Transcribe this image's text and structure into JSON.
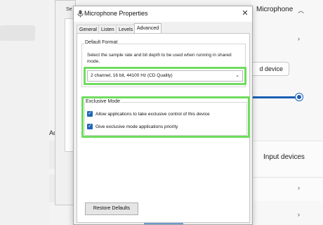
{
  "background": {
    "ad_label": "Ad",
    "microphone_label": "Microphone",
    "add_device_label": "d device",
    "input_devices_label": "Input devices",
    "accent": "#1a5fb4"
  },
  "behind_dialog": {
    "title_fragment": "Se"
  },
  "dialog": {
    "title": "Microphone Properties",
    "close_glyph": "✕",
    "tabs": [
      {
        "label": "General"
      },
      {
        "label": "Listen"
      },
      {
        "label": "Levels"
      },
      {
        "label": "Advanced",
        "active": true
      }
    ],
    "default_format": {
      "group_label": "Default Format",
      "description": "Select the sample rate and bit depth to be used when running in shared mode.",
      "selected_value": "2 channel, 16 bit, 44100 Hz (CD Quality)"
    },
    "exclusive_mode": {
      "group_label": "Exclusive Mode",
      "options": [
        {
          "label": "Allow applications to take exclusive control of this device",
          "checked": true
        },
        {
          "label": "Give exclusive mode applications priority",
          "checked": true
        }
      ]
    },
    "restore_defaults_label": "Restore Defaults"
  },
  "highlight_color": "#6fdc5f"
}
